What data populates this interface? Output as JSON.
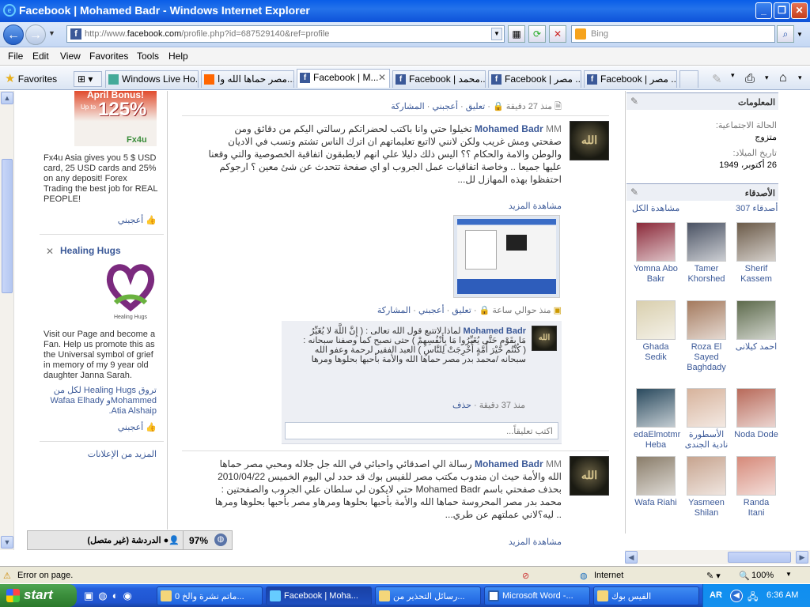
{
  "window": {
    "title": "Facebook | Mohamed Badr - Windows Internet Explorer"
  },
  "address": {
    "url_prefix": "http://www.",
    "url_domain": "facebook.com",
    "url_rest": "/profile.php?id=687529140&ref=profile",
    "search_placeholder": "Bing"
  },
  "menu": [
    "File",
    "Edit",
    "View",
    "Favorites",
    "Tools",
    "Help"
  ],
  "favorites_label": "Favorites",
  "tabs": [
    "Windows Live Ho...",
    "مصر حماها الله وا...",
    "Facebook | M...",
    "Facebook | محمد...",
    "Facebook | مصر ...",
    "Facebook | مصر ..."
  ],
  "ads": {
    "fx_badge_top": "April Bonus!",
    "fx_upto": "Up to",
    "fx_percent": "125%",
    "fx_brand": "Fx4u",
    "fx_text": "Fx4u Asia gives you 5 $ USD card, 25 USD cards and 25% on any deposit! Forex Trading the best job for REAL PEOPLE!",
    "like1": "أعجبني",
    "hh_title": "Healing Hugs",
    "hh_logo_text": "Healing Hugs",
    "hh_text": "Visit our Page and become a Fan. Help us promote this as the Universal symbol of grief in memory of my 9 year old daughter Janna Sarah.",
    "hh_social": "تروق Healing Hugs لكل من Mohammedو Wafaa Elhady Atia Alshaip.",
    "like2": "أعجبني",
    "more_ads": "المزيد من الإعلانات"
  },
  "feed": {
    "top_meta": {
      "time": "منذ 27 دقيقة",
      "comment": "تعليق",
      "like": "أعجبني",
      "share": "المشاركة"
    },
    "post1": {
      "author": "Mohamed Badr",
      "tag": "MM",
      "avatar_text": "الله",
      "text": "تخيلوا حتي وانا باكتب لحضراتكم رسالتي اليكم من دقائق ومن صفحتي ومش غريب ولكن لانني لااتبع تعليماتهم ان اترك الناس تشتم وتسب في الاديان والوطن والامة والحكام ؟؟ اليس ذلك دليلا علي انهم لايطبقون اتفاقية الخصوصية والتي وقعنا عليها جميعا .. وخاصة اتفاقيات عمل الجروب او اي صفحة تتحدث عن شئ معين ؟ ارجوكم احتفظوا بهذه المهازل لل...",
      "see_more": "مشاهدة المزيد",
      "meta": {
        "time": "منذ حوالي ساعة",
        "comment": "تعليق",
        "like": "أعجبني",
        "share": "المشاركة"
      },
      "comment": {
        "author": "Mohamed Badr",
        "text": "لماذا لاتتبع قول الله تعالى : ( إِنَّ اللَّهَ لا يُغَيِّرُ مَا بِقَوْمٍ حَتَّى يُغَيِّرُوا مَا بِأَنْفُسِهِمْ ) حتى نصبح كما وصفنا سبحانه :( كُنْتُم خَيْرَ أُمَّةٍ أُخْرِجَتْ لِلنَّاسِ ) العبد الفقير لرحمة وعفو الله سبحانه /محمد بدر مصر حماها الله والأمة بأحبها بحلوها ومرها",
        "time": "منذ 37 دقيقة",
        "delete": "حذف"
      },
      "comment_placeholder": "اكتب تعليقاً..."
    },
    "post2": {
      "author": "Mohamed Badr",
      "tag": "MM",
      "avatar_text": "الله",
      "text": "رسالة الي اصدقائي واحبائي في الله جل جلاله ومحبي مصر حماها الله والأمة حيث ان مندوب مكتب مصر للفيس بوك قد حدد لي اليوم الخميس 2010/04/22 بحذف صفحتي باسم Mohamed Badr حتي لايكون لي سلطان علي الجروب والصفحتين : محمد بدر مصر المحروسة حماها الله والأمة بأحبها بحلوها ومرهاو مصر بأحبها بحلوها ومرها .. ليه؟لاني عملتهم عن طري...",
      "see_more": "مشاهدة المزيد"
    }
  },
  "info": {
    "heading": "المعلومات",
    "status_label": "الحالة الاجتماعية:",
    "status_value": "متزوج",
    "dob_label": "تاريخ الميلاد:",
    "dob_value": "26 أكتوبر، 1949"
  },
  "friends": {
    "heading": "الأصدقاء",
    "count": "307 أصدقاء",
    "view_all": "مشاهدة الكل",
    "list": [
      {
        "name": "Sherif Kassem",
        "color": "#6b5a48"
      },
      {
        "name": "Tamer Khorshed",
        "color": "#4a5263"
      },
      {
        "name": "Yomna Abo Bakr",
        "color": "#8b2a3a"
      },
      {
        "name": "احمد كيلانى",
        "color": "#5d6a4c"
      },
      {
        "name": "Roza El Sayed Baghdady",
        "color": "#a47a5e"
      },
      {
        "name": "Ghada Sedik",
        "color": "#d9cfae"
      },
      {
        "name": "Noda Dode",
        "color": "#b86a5a"
      },
      {
        "name": "الأسطورة نادية الجندى",
        "color": "#d7b39c"
      },
      {
        "name": "edaElmotmr Heba",
        "color": "#2a4a5e"
      },
      {
        "name": "Randa Itani",
        "color": "#d68a7a"
      },
      {
        "name": "Yasmeen Shilan",
        "color": "#c7a48f"
      },
      {
        "name": "Wafa Riahi",
        "color": "#8a7d6a"
      }
    ]
  },
  "chat": {
    "label": "الدردشة (غير متصل)",
    "zoom": "97%"
  },
  "status": {
    "error": "Error on page.",
    "zone": "Internet",
    "zoom": "100%"
  },
  "taskbar": {
    "start": "start",
    "tasks": [
      "ماتم نشرة والخ 0...",
      "Facebook | Moha...",
      "رسائل التحذير من...",
      "Microsoft Word -...",
      "الفيس بوك"
    ],
    "lang": "AR",
    "clock": "6:36 AM"
  },
  "colors": {
    "fb_blue": "#3b5998",
    "xp_blue": "#245edb",
    "start_green": "#3a8d3b"
  }
}
